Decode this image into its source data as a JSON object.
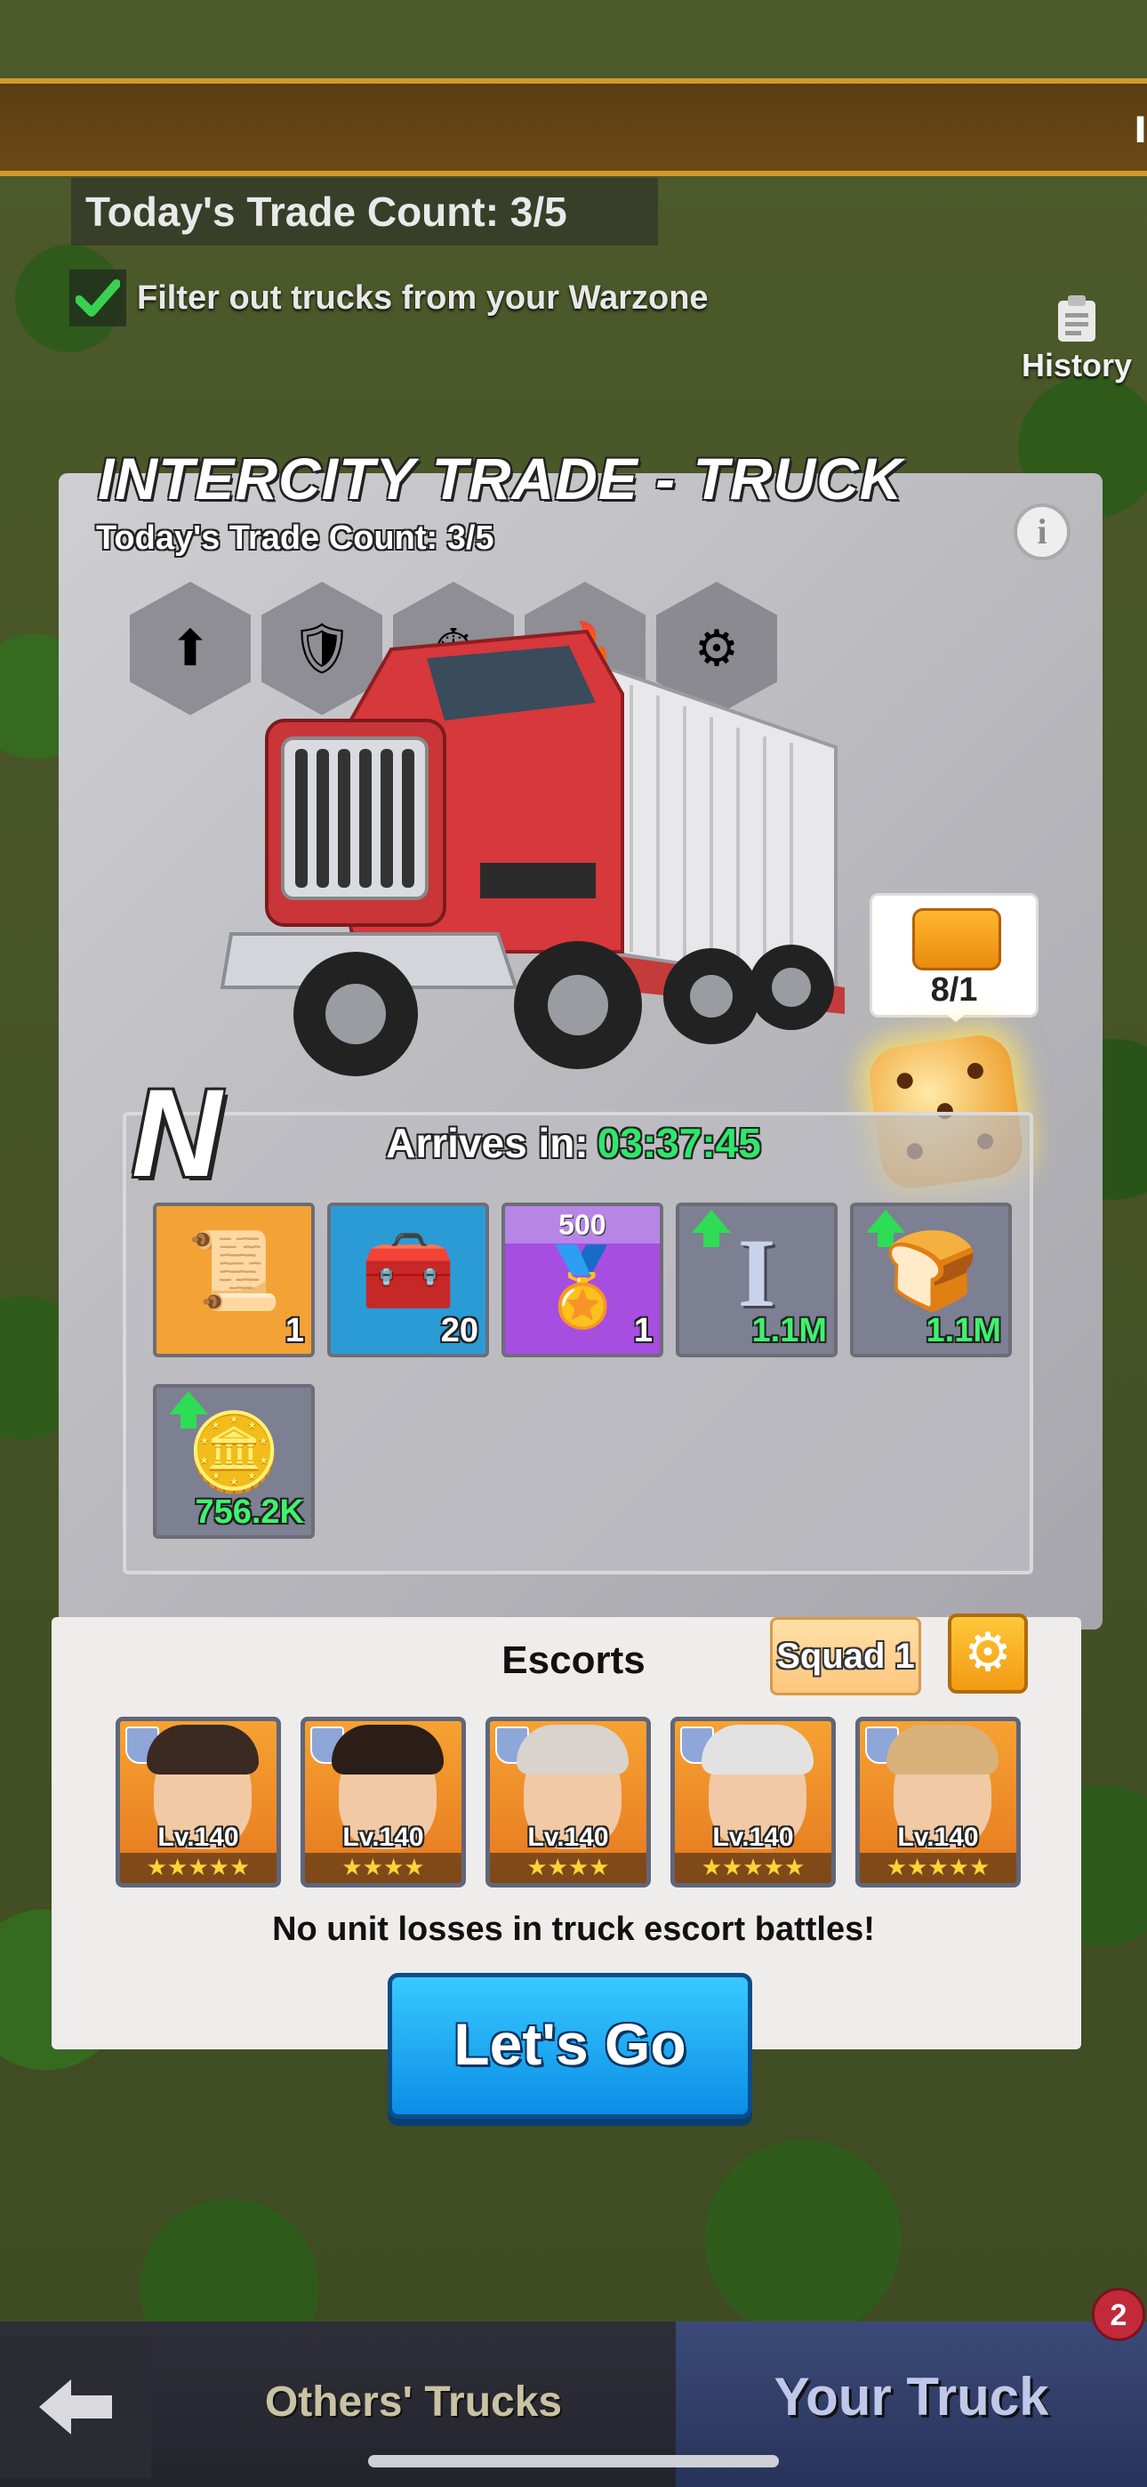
{
  "header": {
    "edge_text": "I",
    "trade_count": "Today's Trade Count: 3/5",
    "filter_label": "Filter out trucks from your Warzone",
    "history_label": "History"
  },
  "panel": {
    "title": "INTERCITY TRADE - TRUCK",
    "subtitle": "Today's Trade Count: 3/5",
    "info_symbol": "i",
    "tooltip_count": "8/1",
    "grade": "N",
    "arrives_label": "Arrives in:",
    "arrives_time": "03:37:45"
  },
  "rewards": [
    {
      "name": "contract-scroll",
      "amount": "1",
      "bg": "#f3a235",
      "icon": "📜"
    },
    {
      "name": "supply-chest",
      "amount": "20",
      "bg": "#2b9bd6",
      "icon": "🧰"
    },
    {
      "name": "gold-medal",
      "amount": "1",
      "bg": "#a64ee0",
      "top": "500",
      "icon": "🏅"
    },
    {
      "name": "steel-beam",
      "amount": "1.1M",
      "bg": "#7d7f92",
      "boost": true,
      "icon": "I"
    },
    {
      "name": "bread",
      "amount": "1.1M",
      "bg": "#7d7f92",
      "boost": true,
      "icon": "🍞"
    },
    {
      "name": "gold-coin",
      "amount": "756.2K",
      "bg": "#7d7f92",
      "boost": true,
      "icon": "🪙"
    }
  ],
  "escorts": {
    "title": "Escorts",
    "squad_label": "Squad 1",
    "heroes": [
      {
        "level": "Lv.140",
        "stars": "★★★★★",
        "hair": "#3a2a22"
      },
      {
        "level": "Lv.140",
        "stars": "★★★★",
        "hair": "#2b1d17"
      },
      {
        "level": "Lv.140",
        "stars": "★★★★",
        "hair": "#d8d3cc"
      },
      {
        "level": "Lv.140",
        "stars": "★★★★★",
        "hair": "#e2e2e2"
      },
      {
        "level": "Lv.140",
        "stars": "★★★★★",
        "hair": "#d8b27a"
      }
    ],
    "note": "No unit losses in truck escort battles!",
    "go_label": "Let's Go"
  },
  "bottom_nav": {
    "others_label": "Others' Trucks",
    "yours_label": "Your Truck",
    "badge_count": "2"
  }
}
